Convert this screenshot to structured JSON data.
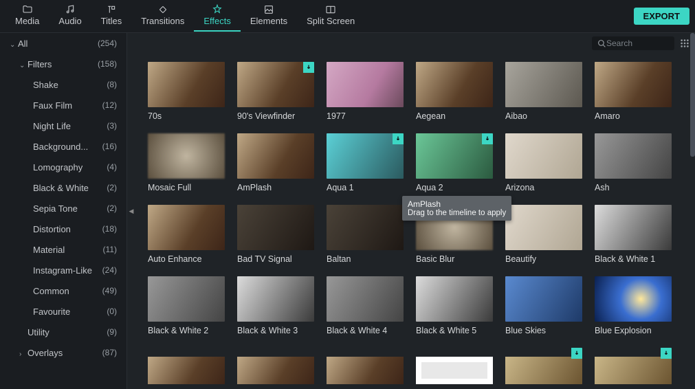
{
  "topbar": {
    "tabs": [
      {
        "label": "Media"
      },
      {
        "label": "Audio"
      },
      {
        "label": "Titles"
      },
      {
        "label": "Transitions"
      },
      {
        "label": "Effects",
        "active": true
      },
      {
        "label": "Elements"
      },
      {
        "label": "Split Screen"
      }
    ],
    "export_label": "EXPORT"
  },
  "search": {
    "placeholder": "Search"
  },
  "sidebar": [
    {
      "label": "All",
      "count": "(254)",
      "level": 1,
      "expanded": true
    },
    {
      "label": "Filters",
      "count": "(158)",
      "level": 2,
      "expanded": true
    },
    {
      "label": "Shake",
      "count": "(8)",
      "level": 3
    },
    {
      "label": "Faux Film",
      "count": "(12)",
      "level": 3
    },
    {
      "label": "Night Life",
      "count": "(3)",
      "level": 3
    },
    {
      "label": "Background...",
      "count": "(16)",
      "level": 3
    },
    {
      "label": "Lomography",
      "count": "(4)",
      "level": 3
    },
    {
      "label": "Black & White",
      "count": "(2)",
      "level": 3
    },
    {
      "label": "Sepia Tone",
      "count": "(2)",
      "level": 3
    },
    {
      "label": "Distortion",
      "count": "(18)",
      "level": 3
    },
    {
      "label": "Material",
      "count": "(11)",
      "level": 3
    },
    {
      "label": "Instagram-Like",
      "count": "(24)",
      "level": 3
    },
    {
      "label": "Common",
      "count": "(49)",
      "level": 3
    },
    {
      "label": "Favourite",
      "count": "(0)",
      "level": 3
    },
    {
      "label": "Utility",
      "count": "(9)",
      "level": 2
    },
    {
      "label": "Overlays",
      "count": "(87)",
      "level": 2,
      "collapsed": true
    }
  ],
  "tooltip": {
    "title": "AmPlash",
    "sub": "Drag to the timeline to apply"
  },
  "effects": [
    [
      {
        "label": "70s",
        "cls": "t-warm"
      },
      {
        "label": "90's Viewfinder",
        "cls": "t-warm",
        "download": true
      },
      {
        "label": "1977",
        "cls": "t-pink"
      },
      {
        "label": "Aegean",
        "cls": "t-warm"
      },
      {
        "label": "Aibao",
        "cls": "t-desat"
      },
      {
        "label": "Amaro",
        "cls": "t-warm"
      }
    ],
    [
      {
        "label": "Mosaic Full",
        "cls": "t-blur"
      },
      {
        "label": "AmPlash",
        "cls": "t-warm"
      },
      {
        "label": "Aqua 1",
        "cls": "t-cyan",
        "download": true
      },
      {
        "label": "Aqua 2",
        "cls": "t-green",
        "download": true
      },
      {
        "label": "Arizona",
        "cls": "t-pale"
      },
      {
        "label": "Ash",
        "cls": "t-gray"
      }
    ],
    [
      {
        "label": "Auto Enhance",
        "cls": "t-warm"
      },
      {
        "label": "Bad TV Signal",
        "cls": "t-dark"
      },
      {
        "label": "Baltan",
        "cls": "t-dark"
      },
      {
        "label": "Basic Blur",
        "cls": "t-blur"
      },
      {
        "label": "Beautify",
        "cls": "t-pale"
      },
      {
        "label": "Black & White 1",
        "cls": "t-bw"
      }
    ],
    [
      {
        "label": "Black & White 2",
        "cls": "t-gray"
      },
      {
        "label": "Black & White 3",
        "cls": "t-bw"
      },
      {
        "label": "Black & White 4",
        "cls": "t-gray"
      },
      {
        "label": "Black & White 5",
        "cls": "t-bw"
      },
      {
        "label": "Blue Skies",
        "cls": "t-bluesky"
      },
      {
        "label": "Blue Explosion",
        "cls": "t-blueexp"
      }
    ],
    [
      {
        "label": "",
        "cls": "t-warm",
        "partial": true
      },
      {
        "label": "",
        "cls": "t-warm",
        "partial": true
      },
      {
        "label": "",
        "cls": "t-warm",
        "partial": true
      },
      {
        "label": "",
        "cls": "t-whiteframe",
        "partial": true
      },
      {
        "label": "",
        "cls": "t-sparkle",
        "partial": true,
        "download": true
      },
      {
        "label": "",
        "cls": "t-sparkle",
        "partial": true,
        "download": true
      }
    ]
  ]
}
